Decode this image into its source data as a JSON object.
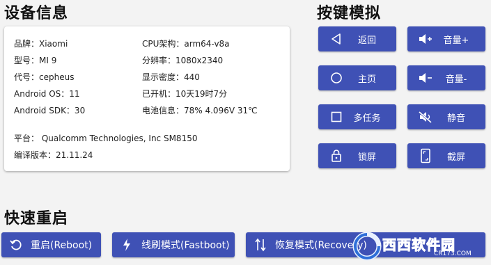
{
  "titles": {
    "device_info": "设备信息",
    "key_sim": "按键模拟",
    "quick_reboot": "快速重启"
  },
  "device": {
    "brand": "品牌：Xiaomi",
    "model": "型号：MI 9",
    "code": "代号：cepheus",
    "android_os": "Android OS：11",
    "android_sdk": "Android SDK：30",
    "cpu": "CPU架构：arm64-v8a",
    "resolution": "分辨率：1080x2340",
    "density": "显示密度：440",
    "uptime": "已开机：10天19时7分",
    "battery": "电池信息：78%  4.096V  31℃",
    "platform": "平台：  Qualcomm Technologies, Inc SM8150",
    "build": "编译版本：21.11.24"
  },
  "keys": {
    "back": "返回",
    "volume_up": "音量+",
    "home": "主页",
    "volume_down": "音量-",
    "multitask": "多任务",
    "mute": "静音",
    "lock": "锁屏",
    "screenshot": "截屏"
  },
  "reboot": {
    "reboot": "重启(Reboot)",
    "fastboot": "线刷模式(Fastboot)",
    "recovery": "恢复模式(Recovery)"
  },
  "watermark": {
    "text": "西西软件园",
    "sub": "CR173.COM"
  },
  "colors": {
    "button": "#3f51b5",
    "background": "#f3f3f3",
    "card": "#ffffff"
  }
}
